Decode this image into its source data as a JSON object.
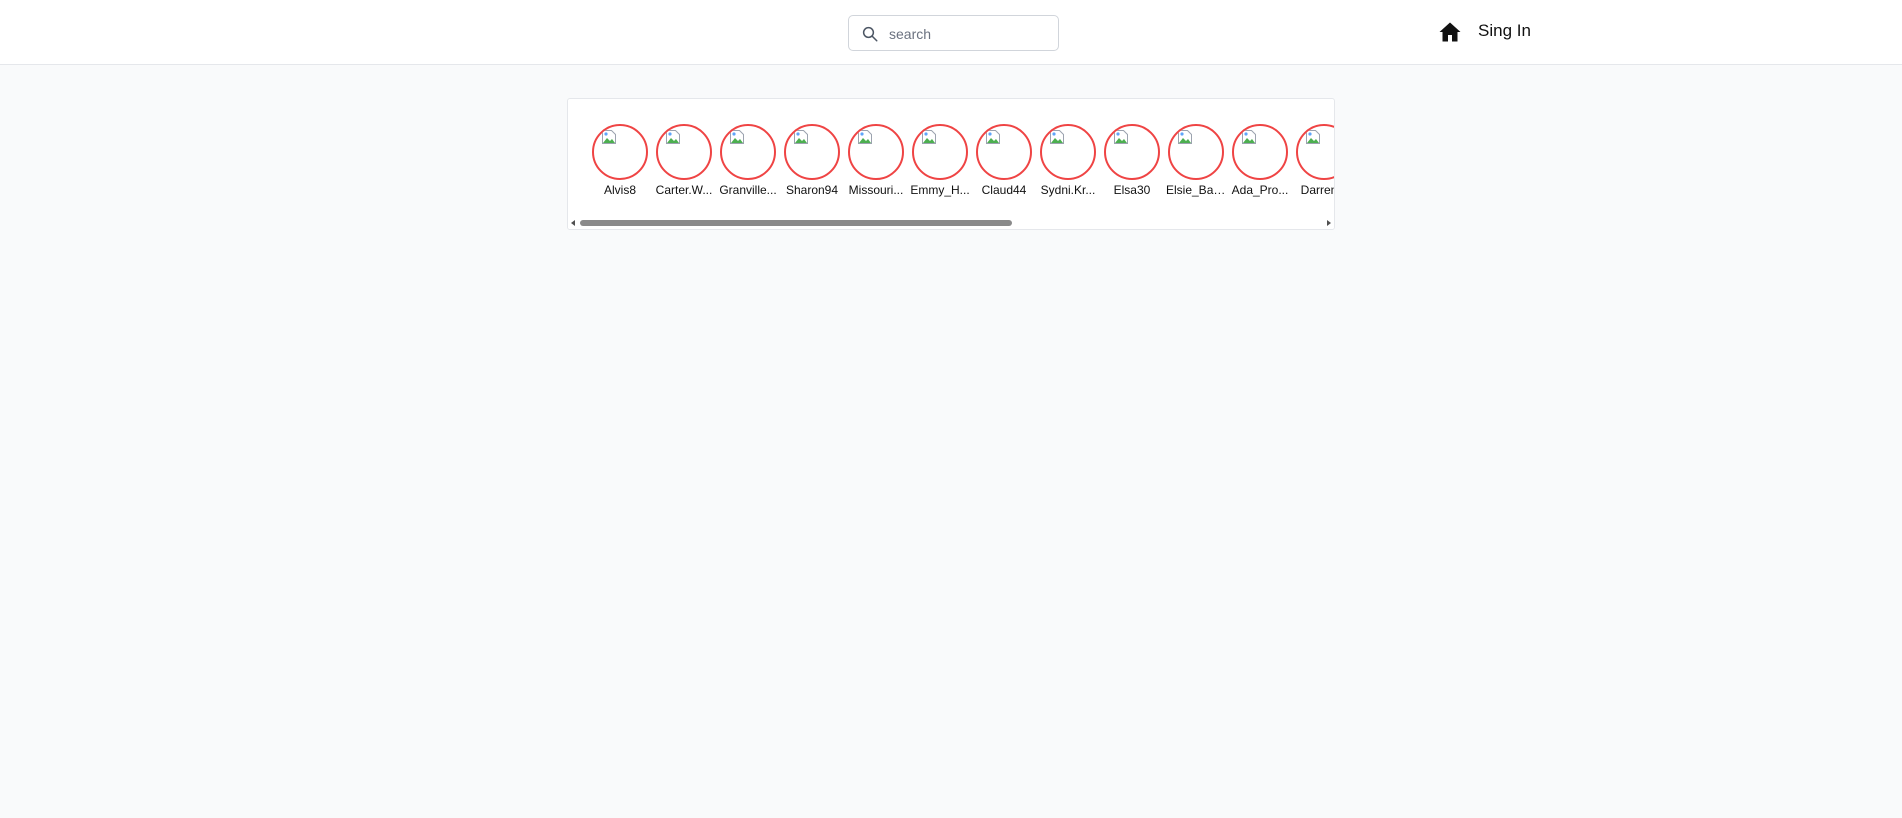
{
  "header": {
    "search": {
      "placeholder": "search",
      "value": ""
    },
    "home_icon": "home-icon",
    "signin_label": "Sing In"
  },
  "stories": [
    {
      "username": "Alvis8"
    },
    {
      "username": "Carter.W..."
    },
    {
      "username": "Granville..."
    },
    {
      "username": "Sharon94"
    },
    {
      "username": "Missouri..."
    },
    {
      "username": "Emmy_H..."
    },
    {
      "username": "Claud44"
    },
    {
      "username": "Sydni.Kr..."
    },
    {
      "username": "Elsa30"
    },
    {
      "username": "Elsie_Bar..."
    },
    {
      "username": "Ada_Pro..."
    },
    {
      "username": "Darren..."
    }
  ],
  "colors": {
    "story_ring": "#ef4444",
    "page_bg": "#f9fafb",
    "header_bg": "#ffffff"
  },
  "scroll": {
    "horizontal_position": 0
  }
}
